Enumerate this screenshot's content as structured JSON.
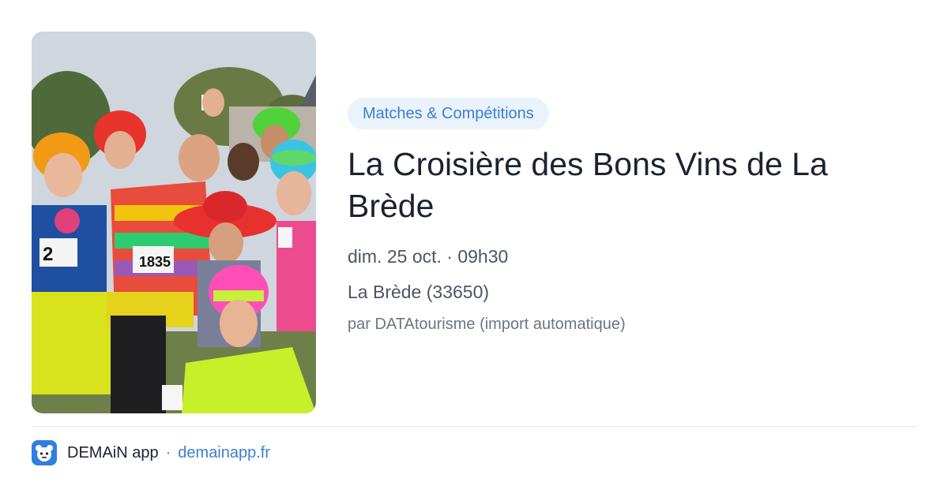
{
  "event": {
    "category": "Matches & Compétitions",
    "title": "La Croisière des Bons Vins de La Brède",
    "datetime": "dim. 25 oct. · 09h30",
    "location": "La Brède (33650)",
    "author": "par DATAtourisme (import automatique)"
  },
  "photo": {
    "bib_numbers": [
      "2",
      "1835"
    ]
  },
  "footer": {
    "app_name": "DEMAiN app",
    "separator": "·",
    "link": "demainapp.fr"
  },
  "colors": {
    "accent": "#3a7fd0",
    "pill_background": "#eaf2fc",
    "title_text": "#1c2230",
    "app_icon": "#2f7fe0"
  }
}
